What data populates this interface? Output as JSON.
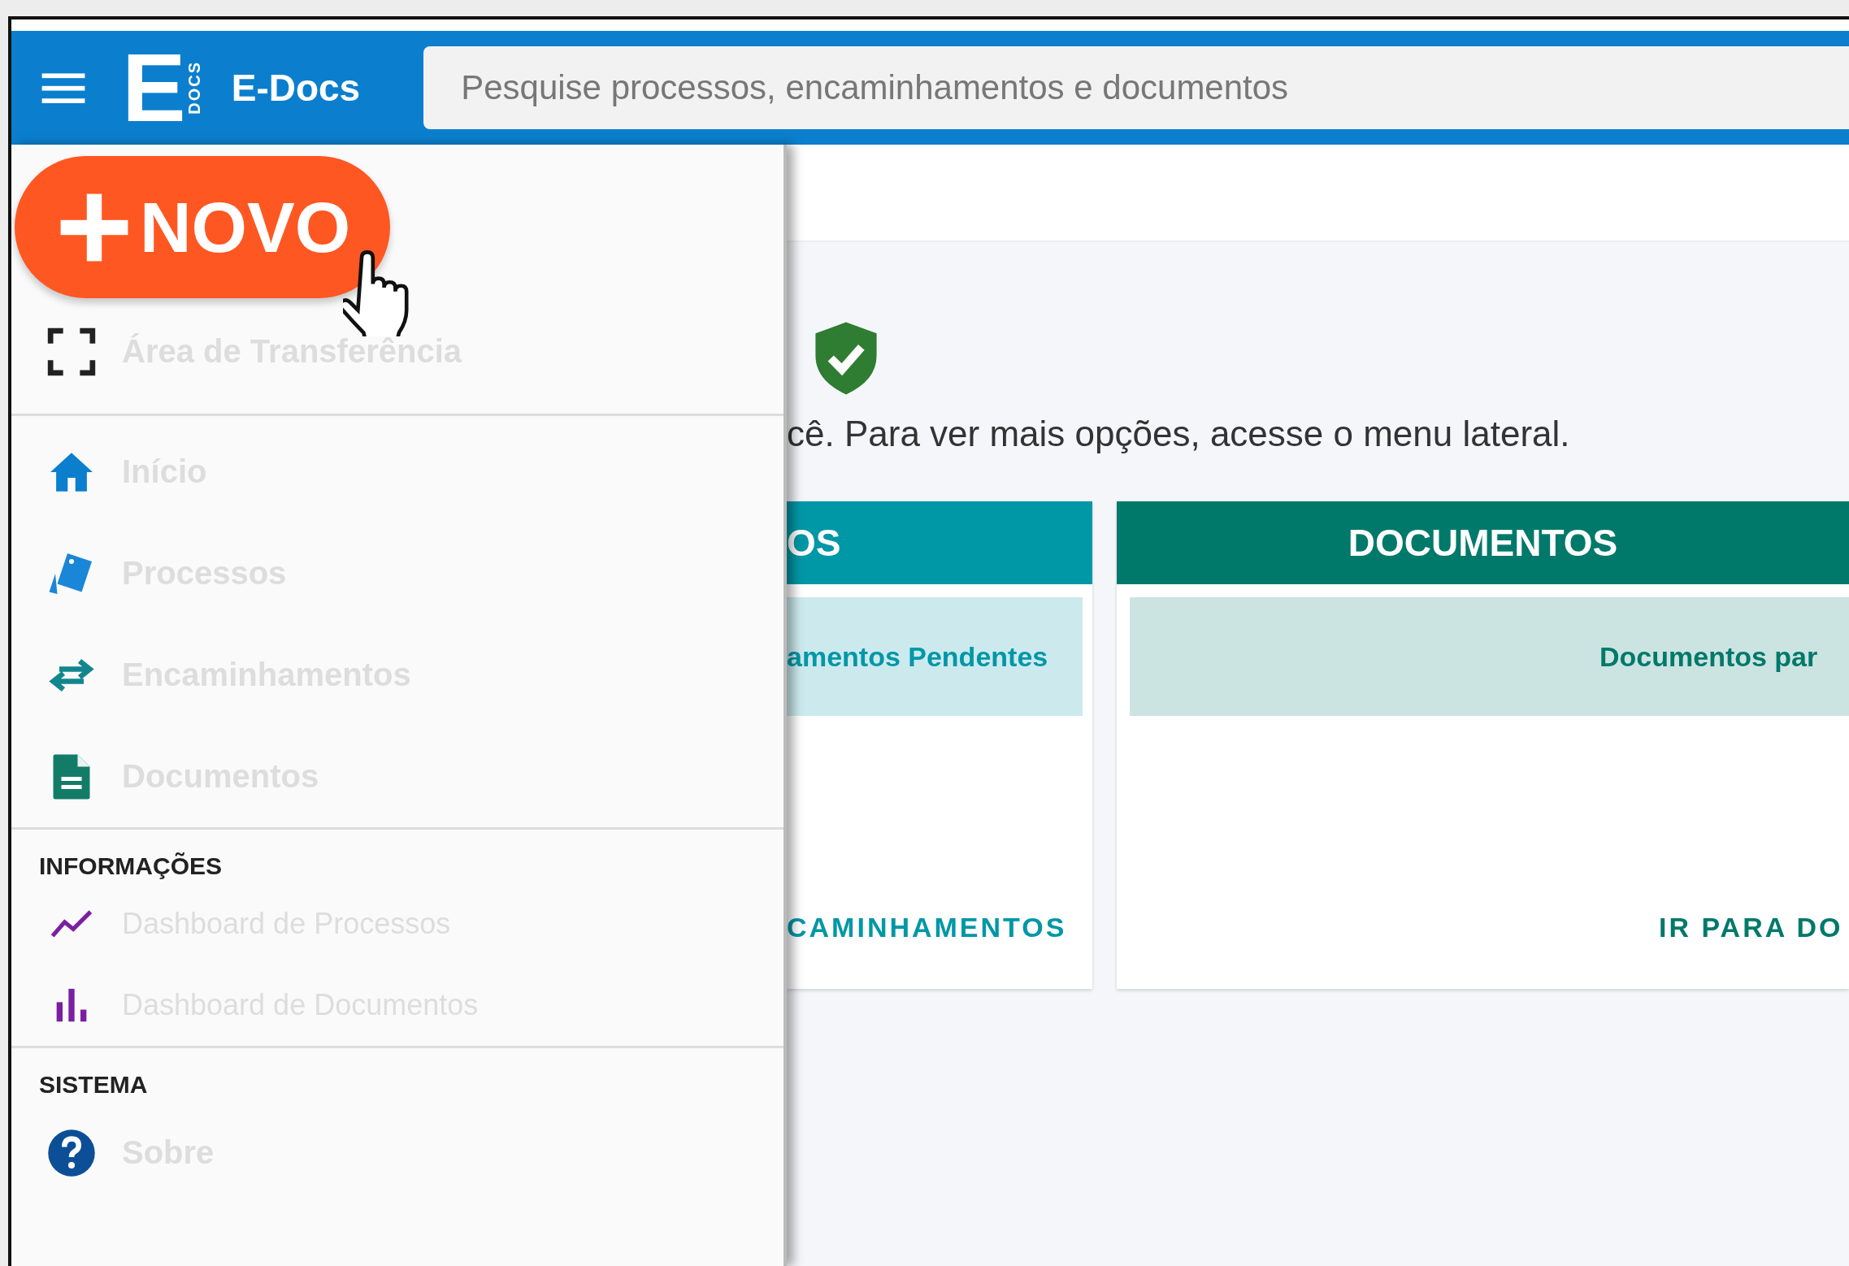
{
  "top_bar": {
    "logo_letter": "E",
    "logo_sub": "DOCS",
    "app_name": "E-Docs",
    "search": {
      "placeholder": "Pesquise processos, encaminhamentos e documentos"
    }
  },
  "sidebar": {
    "new_button": {
      "label": "NOVO"
    },
    "groups": [
      {
        "items": [
          {
            "kind": "clipboard",
            "label": "Área de Transferência",
            "disabled": true
          }
        ]
      },
      {
        "items": [
          {
            "kind": "home",
            "label": "Início",
            "disabled": true
          },
          {
            "kind": "processes",
            "label": "Processos",
            "disabled": true
          },
          {
            "kind": "transfer",
            "label": "Encaminhamentos",
            "disabled": true
          },
          {
            "kind": "document",
            "label": "Documentos",
            "disabled": true
          }
        ]
      },
      {
        "heading": "INFORMAÇÕES",
        "items": [
          {
            "kind": "line-chart",
            "label": "Dashboard de Processos",
            "disabled": true
          },
          {
            "kind": "bar-chart",
            "label": "Dashboard de Documentos",
            "disabled": true
          }
        ]
      },
      {
        "heading": "SISTEMA",
        "items": [
          {
            "kind": "help",
            "label": "Sobre",
            "disabled": true
          }
        ]
      }
    ]
  },
  "main": {
    "message": "cê. Para ver mais opções, acesse o menu lateral.",
    "cards": [
      {
        "title": "OS",
        "subtitle": "amentos Pendentes",
        "link": "CAMINHAMENTOS",
        "color": "#0097a7"
      },
      {
        "title": "DOCUMENTOS",
        "subtitle": "Documentos par",
        "link": "IR PARA DO",
        "color": "#00796b"
      }
    ]
  }
}
